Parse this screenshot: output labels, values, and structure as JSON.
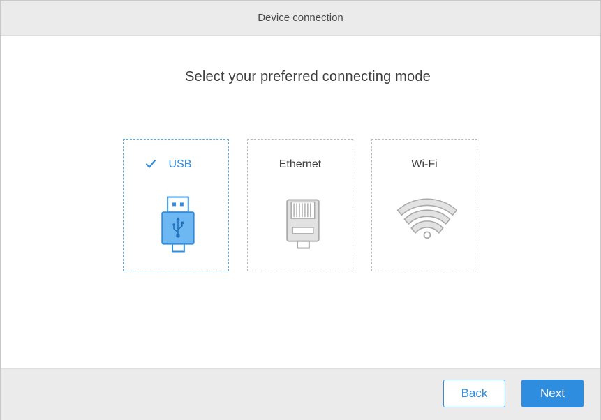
{
  "window": {
    "title": "Device connection"
  },
  "main": {
    "heading": "Select your preferred connecting mode",
    "options": [
      {
        "label": "USB",
        "icon": "usb-icon",
        "selected": true
      },
      {
        "label": "Ethernet",
        "icon": "ethernet-icon",
        "selected": false
      },
      {
        "label": "Wi-Fi",
        "icon": "wifi-icon",
        "selected": false
      }
    ]
  },
  "footer": {
    "back_label": "Back",
    "next_label": "Next"
  },
  "colors": {
    "accent": "#2f8de0",
    "usb_fill": "#6db8f2",
    "icon_gray": "#a9a9a9",
    "titlebar_bg": "#ebebeb"
  }
}
